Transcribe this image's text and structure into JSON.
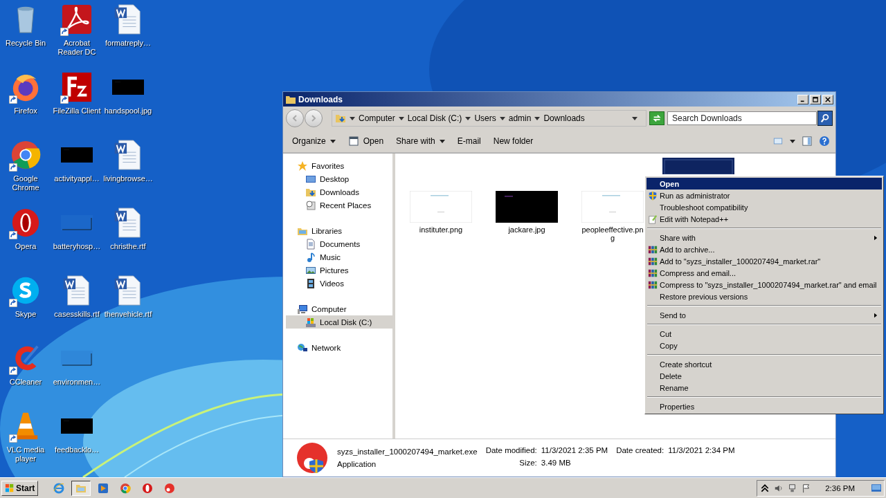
{
  "desktop_icons": [
    {
      "label": "Recycle Bin",
      "kind": "recycle",
      "shortcut": false
    },
    {
      "label": "Firefox",
      "kind": "firefox",
      "shortcut": true
    },
    {
      "label": "Google Chrome",
      "kind": "chrome",
      "shortcut": true
    },
    {
      "label": "Opera",
      "kind": "opera",
      "shortcut": true
    },
    {
      "label": "Skype",
      "kind": "skype",
      "shortcut": true
    },
    {
      "label": "CCleaner",
      "kind": "ccleaner",
      "shortcut": true
    },
    {
      "label": "VLC media player",
      "kind": "vlc",
      "shortcut": true
    },
    {
      "label": "Acrobat Reader DC",
      "kind": "acrobat",
      "shortcut": true
    },
    {
      "label": "FileZilla Client",
      "kind": "filezilla",
      "shortcut": true
    },
    {
      "label": "activityappl…",
      "kind": "dark",
      "shortcut": false
    },
    {
      "label": "batteryhosp…",
      "kind": "blank",
      "shortcut": false
    },
    {
      "label": "casesskills.rtf",
      "kind": "word",
      "shortcut": false
    },
    {
      "label": "environmen…",
      "kind": "blank",
      "shortcut": false
    },
    {
      "label": "feedbacklo…",
      "kind": "dark",
      "shortcut": false
    },
    {
      "label": "formatreply…",
      "kind": "word",
      "shortcut": false
    },
    {
      "label": "handspool.jpg",
      "kind": "dark",
      "shortcut": false
    },
    {
      "label": "livingbrowse…",
      "kind": "word",
      "shortcut": false
    },
    {
      "label": "christhe.rtf",
      "kind": "word",
      "shortcut": false
    },
    {
      "label": "thenvehicle.rtf",
      "kind": "word",
      "shortcut": false
    }
  ],
  "window": {
    "title": "Downloads",
    "breadcrumb": [
      "Computer",
      "Local Disk (C:)",
      "Users",
      "admin",
      "Downloads"
    ],
    "search": {
      "placeholder": "Search Downloads"
    },
    "toolbar": [
      {
        "label": "Organize",
        "kind": "dropdown"
      },
      {
        "label": "Open",
        "kind": "icon"
      },
      {
        "label": "Share with",
        "kind": "dropdown"
      },
      {
        "label": "E-mail",
        "kind": "plain"
      },
      {
        "label": "New folder",
        "kind": "plain"
      }
    ],
    "nav": [
      {
        "label": "Favorites",
        "kind": "star",
        "selected": false,
        "children": [
          {
            "label": "Desktop",
            "kind": "desktop",
            "selected": false
          },
          {
            "label": "Downloads",
            "kind": "downloads",
            "selected": false
          },
          {
            "label": "Recent Places",
            "kind": "recent",
            "selected": false
          }
        ]
      },
      {
        "label": "Libraries",
        "kind": "libraries",
        "selected": false,
        "children": [
          {
            "label": "Documents",
            "kind": "documents",
            "selected": false
          },
          {
            "label": "Music",
            "kind": "music",
            "selected": false
          },
          {
            "label": "Pictures",
            "kind": "pictures",
            "selected": false
          },
          {
            "label": "Videos",
            "kind": "videos",
            "selected": false
          }
        ]
      },
      {
        "label": "Computer",
        "kind": "computer",
        "selected": false,
        "children": [
          {
            "label": "Local Disk (C:)",
            "kind": "disk",
            "selected": true
          }
        ]
      },
      {
        "label": "Network",
        "kind": "network",
        "selected": false
      }
    ],
    "files": [
      {
        "name": "instituter.png",
        "kind": "white",
        "selected": false
      },
      {
        "name": "jackare.jpg",
        "kind": "dark",
        "selected": false
      },
      {
        "name": "peopleeffective.png",
        "kind": "white",
        "selected": false
      },
      {
        "kind": "navy",
        "selected": true
      }
    ],
    "details": {
      "name": "syzs_installer_1000207494_market.exe",
      "type": "Application",
      "modified_label": "Date modified:",
      "modified": "11/3/2021 2:35 PM",
      "size_label": "Size:",
      "size": "3.49 MB",
      "created_label": "Date created:",
      "created": "11/3/2021 2:34 PM"
    }
  },
  "context_menu": {
    "groups": [
      [
        {
          "label": "Open",
          "kind": "plain",
          "default": true,
          "selected": true,
          "submenu": false
        },
        {
          "label": "Run as administrator",
          "kind": "shield",
          "default": false,
          "selected": false,
          "submenu": false
        },
        {
          "label": "Troubleshoot compatibility",
          "kind": "plain",
          "default": false,
          "selected": false,
          "submenu": false
        },
        {
          "label": "Edit with Notepad++",
          "kind": "notepad",
          "default": false,
          "selected": false,
          "submenu": false
        }
      ],
      [
        {
          "label": "Share with",
          "kind": "plain",
          "default": false,
          "selected": false,
          "submenu": true
        },
        {
          "label": "Add to archive...",
          "kind": "archive",
          "default": false,
          "selected": false,
          "submenu": false
        },
        {
          "label": "Add to \"syzs_installer_1000207494_market.rar\"",
          "kind": "archive",
          "default": false,
          "selected": false,
          "submenu": false
        },
        {
          "label": "Compress and email...",
          "kind": "archive",
          "default": false,
          "selected": false,
          "submenu": false
        },
        {
          "label": "Compress to \"syzs_installer_1000207494_market.rar\" and email",
          "kind": "archive",
          "default": false,
          "selected": false,
          "submenu": false
        },
        {
          "label": "Restore previous versions",
          "kind": "plain",
          "default": false,
          "selected": false,
          "submenu": false
        }
      ],
      [
        {
          "label": "Send to",
          "kind": "plain",
          "default": false,
          "selected": false,
          "submenu": true
        }
      ],
      [
        {
          "label": "Cut",
          "kind": "plain",
          "default": false,
          "selected": false,
          "submenu": false
        },
        {
          "label": "Copy",
          "kind": "plain",
          "default": false,
          "selected": false,
          "submenu": false
        }
      ],
      [
        {
          "label": "Create shortcut",
          "kind": "plain",
          "default": false,
          "selected": false,
          "submenu": false
        },
        {
          "label": "Delete",
          "kind": "plain",
          "default": false,
          "selected": false,
          "submenu": false
        },
        {
          "label": "Rename",
          "kind": "plain",
          "default": false,
          "selected": false,
          "submenu": false
        }
      ],
      [
        {
          "label": "Properties",
          "kind": "plain",
          "default": false,
          "selected": false,
          "submenu": false
        }
      ]
    ]
  },
  "taskbar": {
    "start": "Start",
    "apps": [
      {
        "kind": "ie",
        "active": false
      },
      {
        "kind": "explorer",
        "active": true
      },
      {
        "kind": "media",
        "active": false
      },
      {
        "kind": "chrome",
        "active": false
      },
      {
        "kind": "opera",
        "active": false
      },
      {
        "kind": "installer",
        "active": false
      }
    ],
    "clock": "2:36 PM"
  }
}
